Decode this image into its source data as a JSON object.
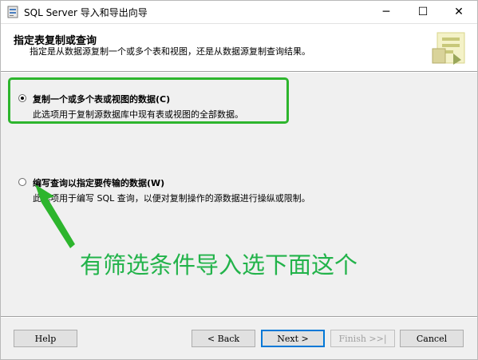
{
  "window": {
    "title": "SQL Server 导入和导出向导",
    "minimize_glyph": "─",
    "maximize_glyph": "☐",
    "close_glyph": "✕"
  },
  "header": {
    "title": "指定表复制或查询",
    "subtitle": "指定是从数据源复制一个或多个表和视图，还是从数据源复制查询结果。"
  },
  "options": [
    {
      "label": "复制一个或多个表或视图的数据(C)",
      "description": "此选项用于复制源数据库中现有表或视图的全部数据。",
      "selected": true
    },
    {
      "label": "编写查询以指定要传输的数据(W)",
      "description": "此选项用于编写 SQL 查询，以便对复制操作的源数据进行操纵或限制。",
      "selected": false
    }
  ],
  "annotation": {
    "text": "有筛选条件导入选下面这个",
    "color": "#22b34a"
  },
  "buttons": {
    "help": "Help",
    "back": "< Back",
    "next": "Next >",
    "finish": "Finish >>|",
    "cancel": "Cancel"
  }
}
